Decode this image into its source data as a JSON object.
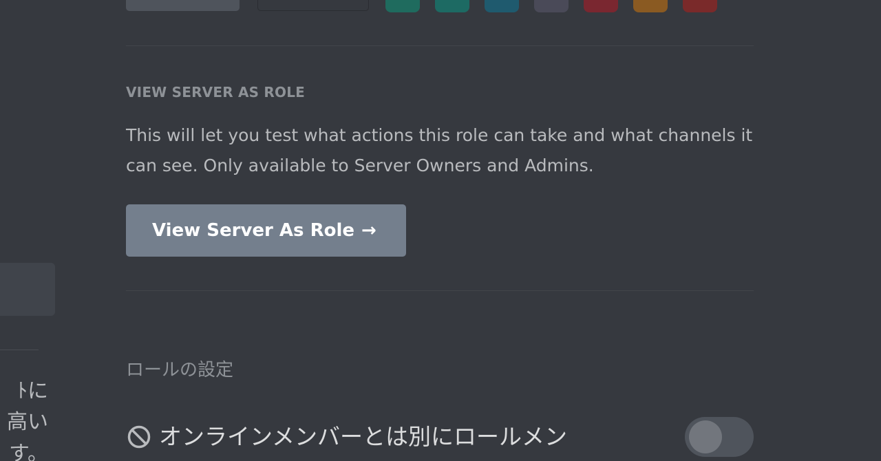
{
  "colors": {
    "background": "#36393f",
    "view_button": "#747f8d",
    "swatches": [
      "#1f6b5e",
      "#1d6a63",
      "#1f5a6e",
      "#4a4a58",
      "#7a2730",
      "#8a5a22",
      "#7a2a2a"
    ]
  },
  "sidebar": {
    "text_lines": [
      "ﾄに",
      "高い",
      "す。"
    ]
  },
  "view_as_role": {
    "title": "VIEW SERVER AS ROLE",
    "description": "This will let you test what actions this role can take and what channels it can see. Only available to Server Owners and Admins.",
    "button_label": "View Server As Role",
    "button_arrow": "→"
  },
  "role_settings": {
    "heading": "ロールの設定",
    "option_label": "オンラインメンバーとは別にロールメン",
    "option_icon": "block-icon",
    "toggle_on": false
  }
}
